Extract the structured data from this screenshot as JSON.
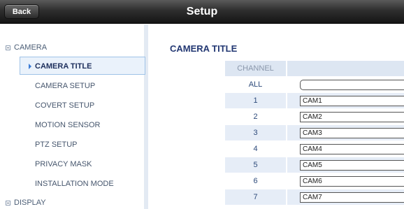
{
  "header": {
    "back_label": "Back",
    "title": "Setup"
  },
  "sidebar": {
    "camera_group": "CAMERA",
    "items": [
      {
        "label": "CAMERA TITLE",
        "active": true
      },
      {
        "label": "CAMERA SETUP"
      },
      {
        "label": "COVERT SETUP"
      },
      {
        "label": "MOTION SENSOR"
      },
      {
        "label": "PTZ SETUP"
      },
      {
        "label": "PRIVACY MASK"
      },
      {
        "label": "INSTALLATION MODE"
      }
    ],
    "display_group": "DISPLAY"
  },
  "main": {
    "section_title": "CAMERA TITLE",
    "column_header": "CHANNEL",
    "rows": [
      {
        "channel": "ALL",
        "title": ""
      },
      {
        "channel": "1",
        "title": "CAM1"
      },
      {
        "channel": "2",
        "title": "CAM2"
      },
      {
        "channel": "3",
        "title": "CAM3"
      },
      {
        "channel": "4",
        "title": "CAM4"
      },
      {
        "channel": "5",
        "title": "CAM5"
      },
      {
        "channel": "6",
        "title": "CAM6"
      },
      {
        "channel": "7",
        "title": "CAM7"
      }
    ]
  }
}
